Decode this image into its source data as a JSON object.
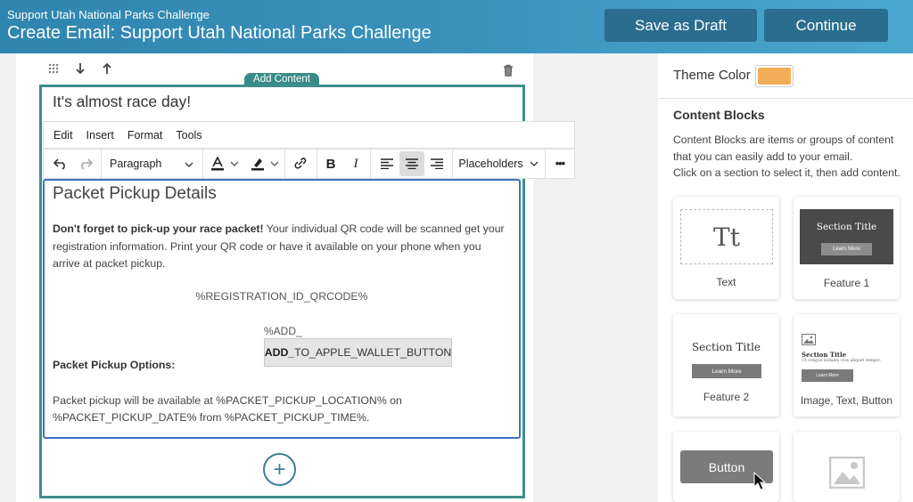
{
  "header": {
    "subtitle": "Support Utah National Parks Challenge",
    "title": "Create Email: Support Utah National Parks Challenge",
    "save_draft_label": "Save as Draft",
    "continue_label": "Continue"
  },
  "editor": {
    "add_content_tag": "Add Content",
    "heading": "It's almost race day!",
    "menu": [
      "Edit",
      "Insert",
      "Format",
      "Tools"
    ],
    "toolbar": {
      "format_select": "Paragraph",
      "placeholders_select": "Placeholders",
      "bold": "B",
      "italic": "I",
      "more": "•••"
    },
    "content": {
      "title": "Packet Pickup Details",
      "intro_bold": "Don't forget to pick-up your race packet!",
      "intro_rest": " Your individual QR code will be scanned get your registration information. Print your QR code or have it available on your phone when you arrive at packet pickup.",
      "qrcode_placeholder": "%REGISTRATION_ID_QRCODE%",
      "add_prefix": "%ADD_",
      "apple_btn_bold": "ADD_",
      "apple_btn_rest": "TO_APPLE_WALLET_BUTTON",
      "pickup_options_label": "Packet Pickup Options:",
      "pickup_text": "Packet pickup will be available at %PACKET_PICKUP_LOCATION% on %PACKET_PICKUP_DATE% from %PACKET_PICKUP_TIME%."
    },
    "add_block": "+"
  },
  "panel": {
    "theme_label": "Theme Color",
    "theme_color": "#f2ad56",
    "blocks_title": "Content Blocks",
    "blocks_desc_1": "Content Blocks are items or groups of content that you can easily add to your email.",
    "blocks_desc_2": "Click on a section to select it, then add content.",
    "cards": {
      "text": {
        "glyph": "Tt",
        "label": "Text"
      },
      "feature1": {
        "title": "Section Title",
        "button": "Learn More",
        "label": "Feature 1"
      },
      "feature2": {
        "title": "Section Title",
        "button": "Learn More",
        "label": "Feature 2"
      },
      "itb": {
        "title": "Section Title",
        "text": "Ut congue sodales cras aliquet tempor.",
        "button": "Learn More",
        "label": "Image, Text, Button"
      },
      "button": {
        "button": "Button"
      }
    }
  }
}
